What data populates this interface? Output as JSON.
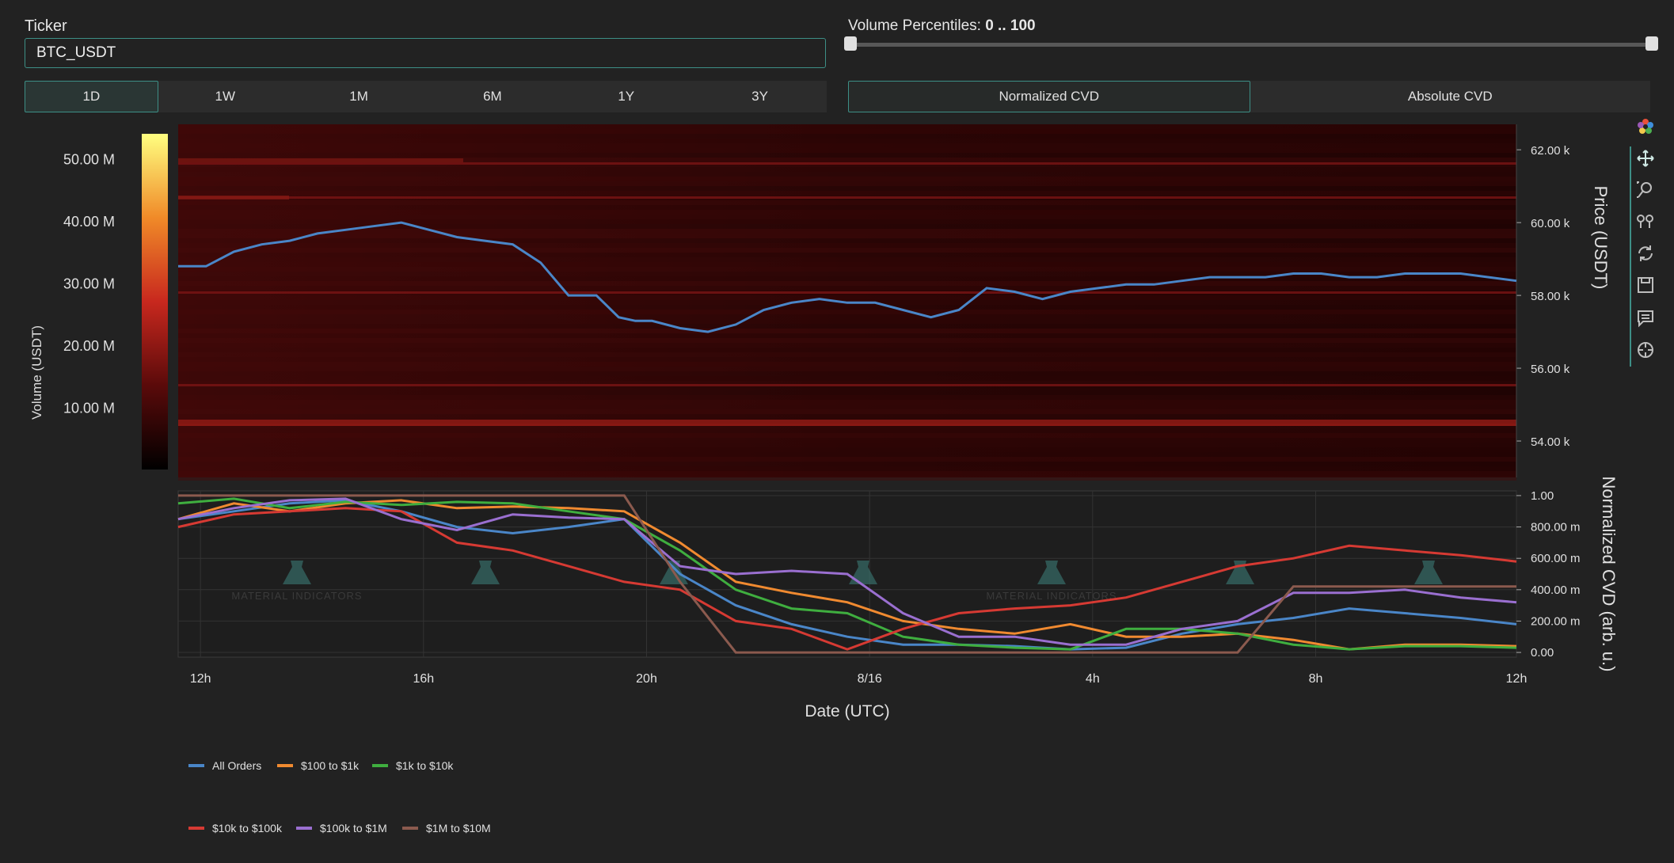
{
  "ticker": {
    "label": "Ticker",
    "value": "BTC_USDT"
  },
  "volume_percentiles": {
    "label": "Volume Percentiles:",
    "value": "0 .. 100"
  },
  "timeframes": [
    "1D",
    "1W",
    "1M",
    "6M",
    "1Y",
    "3Y"
  ],
  "active_timeframe": "1D",
  "cvd_modes": [
    "Normalized CVD",
    "Absolute CVD"
  ],
  "active_cvd_mode": "Normalized CVD",
  "toolbar": [
    "logo-icon",
    "pan-icon",
    "zoom-icon",
    "compare-icon",
    "reset-icon",
    "save-icon",
    "hover-icon",
    "spike-icon"
  ],
  "colors": {
    "accent": "#3d8f86",
    "all_orders": "#4a86c8",
    "s100_1k": "#f08a30",
    "s1k_10k": "#3fae3f",
    "s10k_100k": "#d63a33",
    "s100k_1m": "#9a6fd0",
    "s1m_10m": "#8b5a4e"
  },
  "chart_data": [
    {
      "type": "heatmap",
      "ylabel": "Price (USDT)",
      "colorbar_label": "Volume (USDT)",
      "colorbar_ticks": [
        "50.00 M",
        "40.00 M",
        "30.00 M",
        "20.00 M",
        "10.00 M"
      ],
      "colorbar_range": [
        0,
        54
      ],
      "yticks": [
        "62.00 k",
        "60.00 k",
        "58.00 k",
        "56.00 k",
        "54.00 k"
      ],
      "ylim": [
        53,
        62.7
      ],
      "price_series": {
        "name": "Price",
        "x": [
          0,
          0.5,
          1,
          1.5,
          2,
          2.5,
          3,
          3.5,
          4,
          4.5,
          5,
          5.5,
          6,
          6.5,
          7,
          7.5,
          7.9,
          8.2,
          8.5,
          9,
          9.5,
          10,
          10.5,
          11,
          11.5,
          12,
          12.5,
          13,
          13.5,
          14,
          14.5,
          15,
          15.5,
          16,
          16.5,
          17,
          17.5,
          18,
          18.5,
          19,
          19.5,
          20,
          20.5,
          21,
          21.5,
          22,
          22.5,
          23,
          23.5,
          24
        ],
        "y": [
          58.8,
          58.8,
          59.2,
          59.4,
          59.5,
          59.7,
          59.8,
          59.9,
          60.0,
          59.8,
          59.6,
          59.5,
          59.4,
          58.9,
          58.0,
          58.0,
          57.4,
          57.3,
          57.3,
          57.1,
          57.0,
          57.2,
          57.6,
          57.8,
          57.9,
          57.8,
          57.8,
          57.6,
          57.4,
          57.6,
          58.2,
          58.1,
          57.9,
          58.1,
          58.2,
          58.3,
          58.3,
          58.4,
          58.5,
          58.5,
          58.5,
          58.6,
          58.6,
          58.5,
          58.5,
          58.6,
          58.6,
          58.6,
          58.5,
          58.4
        ]
      }
    },
    {
      "type": "line",
      "xlabel": "Date (UTC)",
      "ylabel": "Normalized CVD (arb. u.)",
      "xticks": [
        "12h",
        "16h",
        "20h",
        "8/16",
        "4h",
        "8h",
        "12h"
      ],
      "yticks": [
        "1.00",
        "800.00 m",
        "600.00 m",
        "400.00 m",
        "200.00 m",
        "0.00"
      ],
      "ylim": [
        -0.03,
        1.03
      ],
      "x": [
        0,
        1,
        2,
        3,
        4,
        5,
        6,
        7,
        8,
        9,
        10,
        11,
        12,
        13,
        14,
        15,
        16,
        17,
        18,
        19,
        20,
        21,
        22,
        23,
        24
      ],
      "series": [
        {
          "name": "All Orders",
          "values": [
            0.85,
            0.9,
            0.95,
            0.97,
            0.9,
            0.8,
            0.76,
            0.8,
            0.85,
            0.5,
            0.3,
            0.18,
            0.1,
            0.05,
            0.05,
            0.04,
            0.02,
            0.03,
            0.12,
            0.18,
            0.22,
            0.28,
            0.25,
            0.22,
            0.18
          ]
        },
        {
          "name": "$100 to $1k",
          "values": [
            0.85,
            0.95,
            0.9,
            0.95,
            0.97,
            0.92,
            0.93,
            0.92,
            0.9,
            0.7,
            0.45,
            0.38,
            0.32,
            0.2,
            0.15,
            0.12,
            0.18,
            0.1,
            0.1,
            0.12,
            0.08,
            0.02,
            0.05,
            0.05,
            0.04
          ]
        },
        {
          "name": "$1k to $10k",
          "values": [
            0.95,
            0.98,
            0.92,
            0.96,
            0.94,
            0.96,
            0.95,
            0.9,
            0.85,
            0.65,
            0.4,
            0.28,
            0.25,
            0.1,
            0.05,
            0.03,
            0.02,
            0.15,
            0.15,
            0.12,
            0.05,
            0.02,
            0.04,
            0.04,
            0.03
          ]
        },
        {
          "name": "$10k to $100k",
          "values": [
            0.8,
            0.88,
            0.9,
            0.92,
            0.9,
            0.7,
            0.65,
            0.55,
            0.45,
            0.4,
            0.2,
            0.15,
            0.02,
            0.15,
            0.25,
            0.28,
            0.3,
            0.35,
            0.45,
            0.55,
            0.6,
            0.68,
            0.65,
            0.62,
            0.58
          ]
        },
        {
          "name": "$100k to $1M",
          "values": [
            0.85,
            0.92,
            0.97,
            0.98,
            0.85,
            0.78,
            0.88,
            0.86,
            0.85,
            0.55,
            0.5,
            0.52,
            0.5,
            0.25,
            0.1,
            0.1,
            0.05,
            0.05,
            0.15,
            0.2,
            0.38,
            0.38,
            0.4,
            0.35,
            0.32
          ]
        },
        {
          "name": "$1M to $10M",
          "values": [
            1.0,
            1.0,
            1.0,
            1.0,
            1.0,
            1.0,
            1.0,
            1.0,
            1.0,
            0.45,
            0.0,
            0.0,
            0.0,
            0.0,
            0.0,
            0.0,
            0.0,
            0.0,
            0.0,
            0.0,
            0.42,
            0.42,
            0.42,
            0.42,
            0.42
          ]
        }
      ],
      "watermark": "MATERIAL INDICATORS"
    }
  ]
}
